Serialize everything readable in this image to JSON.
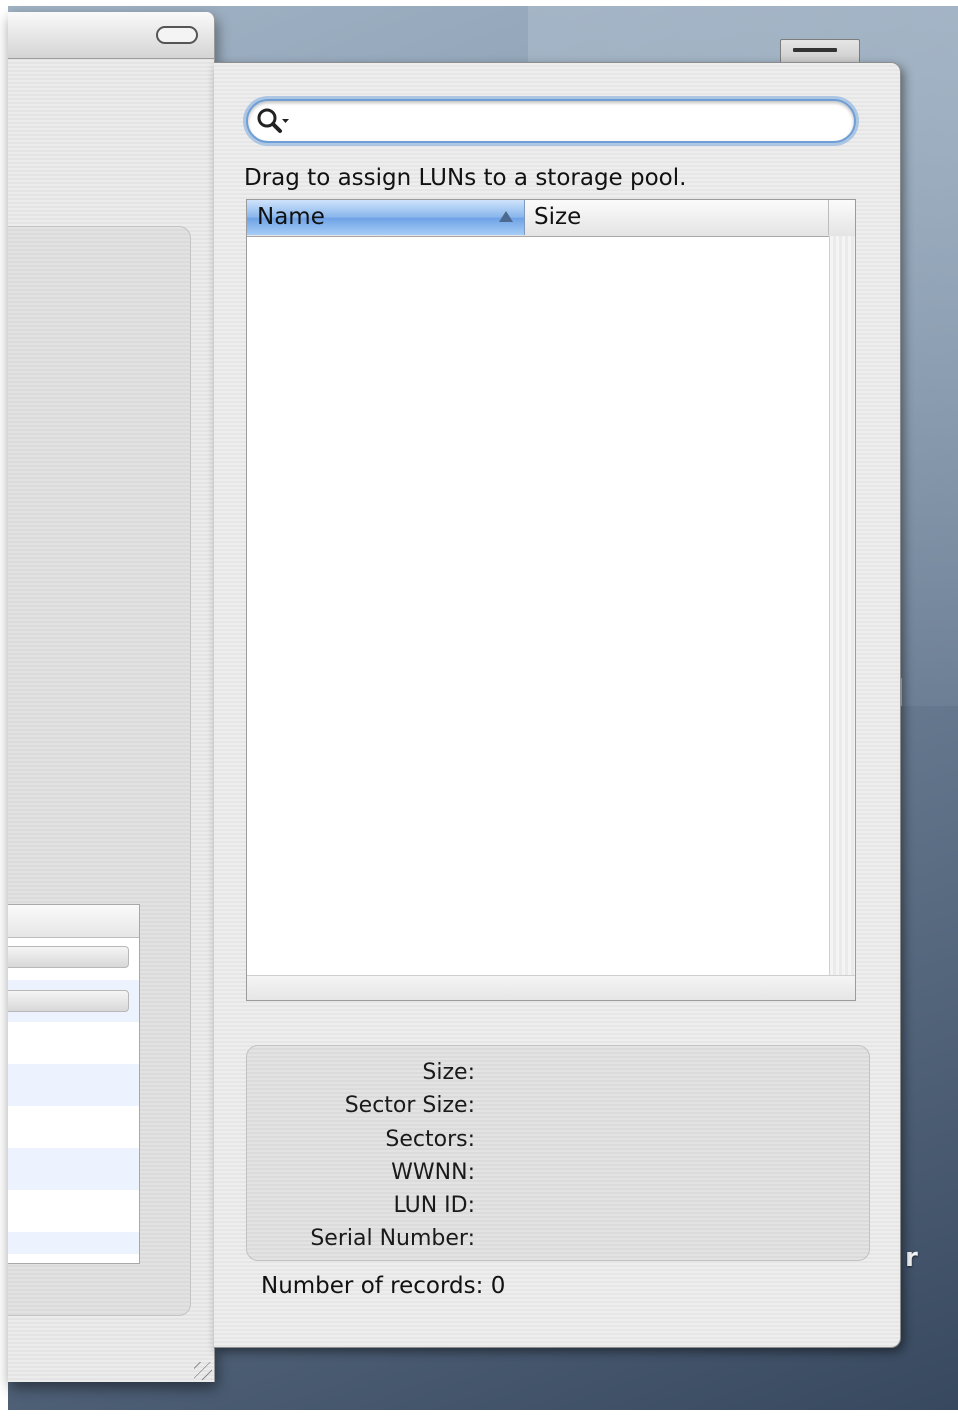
{
  "drawer": {
    "search": {
      "placeholder": "",
      "value": ""
    },
    "hint": "Drag to assign LUNs to a storage pool.",
    "table": {
      "columns": [
        "Name",
        "Size"
      ],
      "sort_column": "Name",
      "sort_direction": "ascending",
      "rows": []
    },
    "info": {
      "size_label": "Size:",
      "sector_size_label": "Sector Size:",
      "sectors_label": "Sectors:",
      "wwnn_label": "WWNN:",
      "lun_id_label": "LUN ID:",
      "serial_number_label": "Serial Number:"
    },
    "records_label": "Number of records: 0"
  },
  "desktop": {
    "partial_label": "r"
  },
  "colors": {
    "selected_header": "#88b5ec",
    "search_focus_ring": "#6f9ed4",
    "desktop": "#5a6e87"
  }
}
